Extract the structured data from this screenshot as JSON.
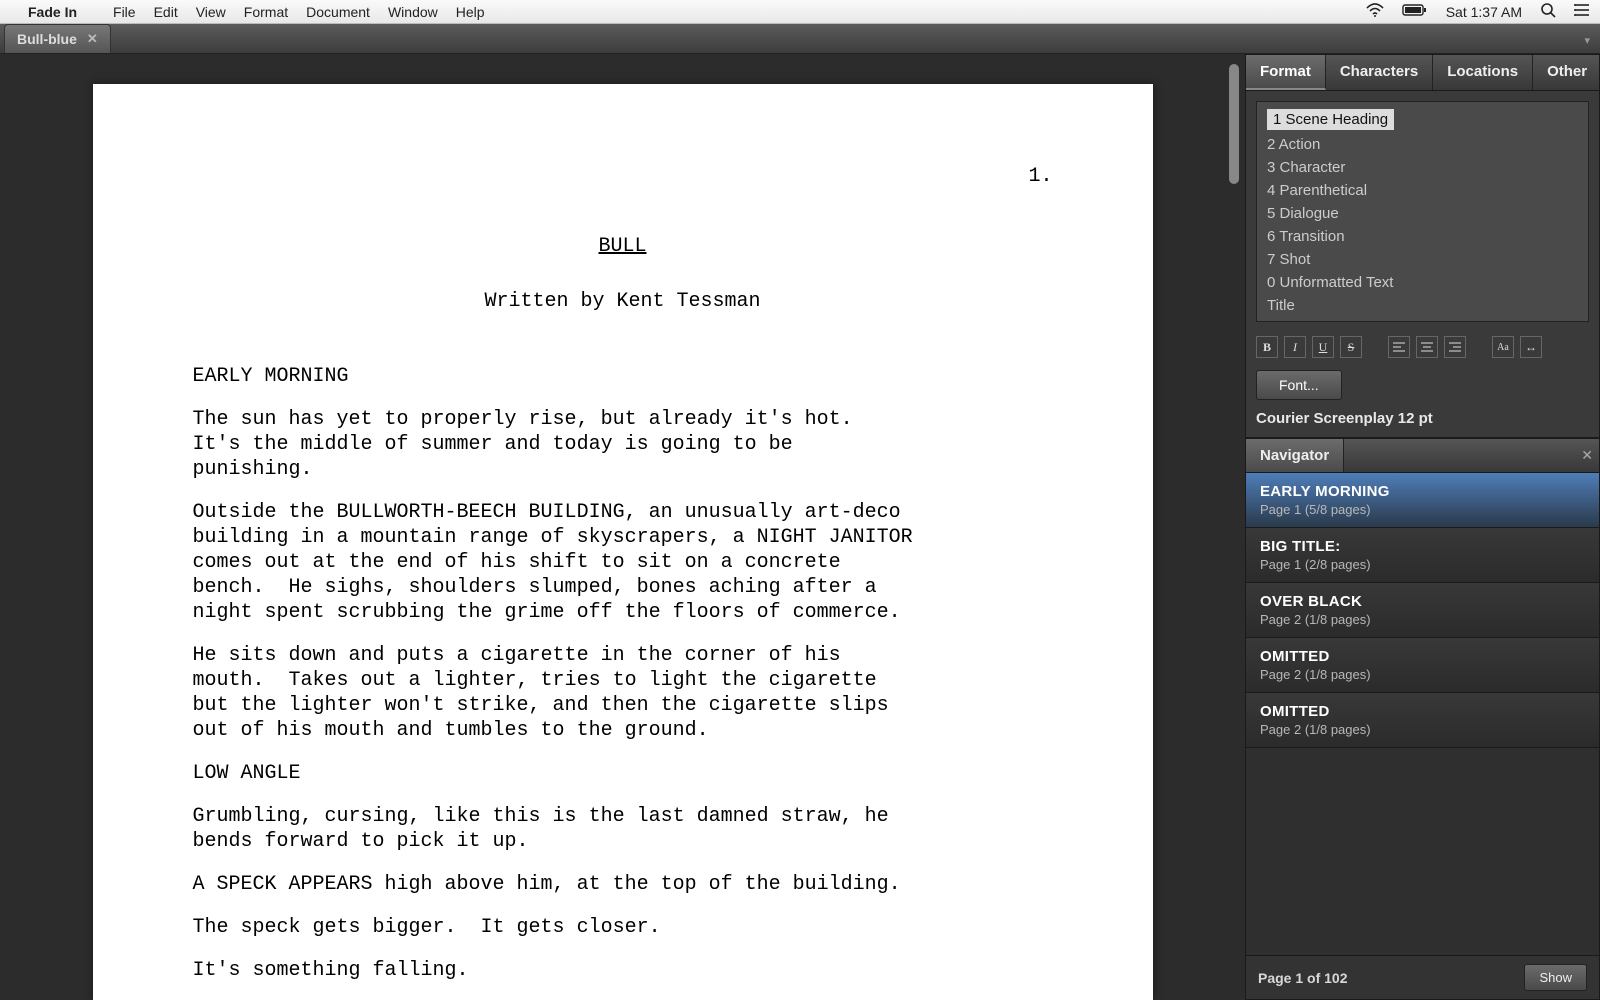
{
  "menubar": {
    "appname": "Fade In",
    "items": [
      "File",
      "Edit",
      "View",
      "Format",
      "Document",
      "Window",
      "Help"
    ],
    "clock": "Sat 1:37 AM"
  },
  "doctab": {
    "label": "Bull-blue"
  },
  "script": {
    "pagenum": "1.",
    "title": "BULL",
    "byline": "Written by Kent Tessman",
    "blocks": [
      {
        "type": "scene",
        "text": "EARLY MORNING"
      },
      {
        "type": "action",
        "text": "The sun has yet to properly rise, but already it's hot.\nIt's the middle of summer and today is going to be\npunishing."
      },
      {
        "type": "action",
        "text": "Outside the BULLWORTH-BEECH BUILDING, an unusually art-deco\nbuilding in a mountain range of skyscrapers, a NIGHT JANITOR\ncomes out at the end of his shift to sit on a concrete\nbench.  He sighs, shoulders slumped, bones aching after a\nnight spent scrubbing the grime off the floors of commerce."
      },
      {
        "type": "action",
        "text": "He sits down and puts a cigarette in the corner of his\nmouth.  Takes out a lighter, tries to light the cigarette\nbut the lighter won't strike, and then the cigarette slips\nout of his mouth and tumbles to the ground."
      },
      {
        "type": "scene",
        "text": "LOW ANGLE"
      },
      {
        "type": "action",
        "text": "Grumbling, cursing, like this is the last damned straw, he\nbends forward to pick it up."
      },
      {
        "type": "action",
        "text": "A SPECK APPEARS high above him, at the top of the building."
      },
      {
        "type": "action",
        "text": "The speck gets bigger.  It gets closer."
      },
      {
        "type": "action",
        "text": "It's something falling."
      }
    ]
  },
  "formatpanel": {
    "tabs": [
      "Format",
      "Characters",
      "Locations",
      "Other"
    ],
    "activeTab": 0,
    "items": [
      "1 Scene Heading",
      "2 Action",
      "3 Character",
      "4 Parenthetical",
      "5 Dialogue",
      "6 Transition",
      "7 Shot",
      "0 Unformatted Text",
      "Title"
    ],
    "selected": 0,
    "fontButton": "Font...",
    "fontLabel": "Courier Screenplay 12 pt"
  },
  "navigator": {
    "title": "Navigator",
    "items": [
      {
        "title": "EARLY MORNING",
        "sub": "Page 1 (5/8 pages)",
        "selected": true
      },
      {
        "title": "BIG TITLE:",
        "sub": "Page 1 (2/8 pages)"
      },
      {
        "title": "OVER BLACK",
        "sub": "Page 2 (1/8 pages)"
      },
      {
        "title": "OMITTED",
        "sub": "Page 2 (1/8 pages)"
      },
      {
        "title": "OMITTED",
        "sub": "Page 2 (1/8 pages)"
      }
    ],
    "footer": "Page 1 of 102",
    "showButton": "Show"
  }
}
